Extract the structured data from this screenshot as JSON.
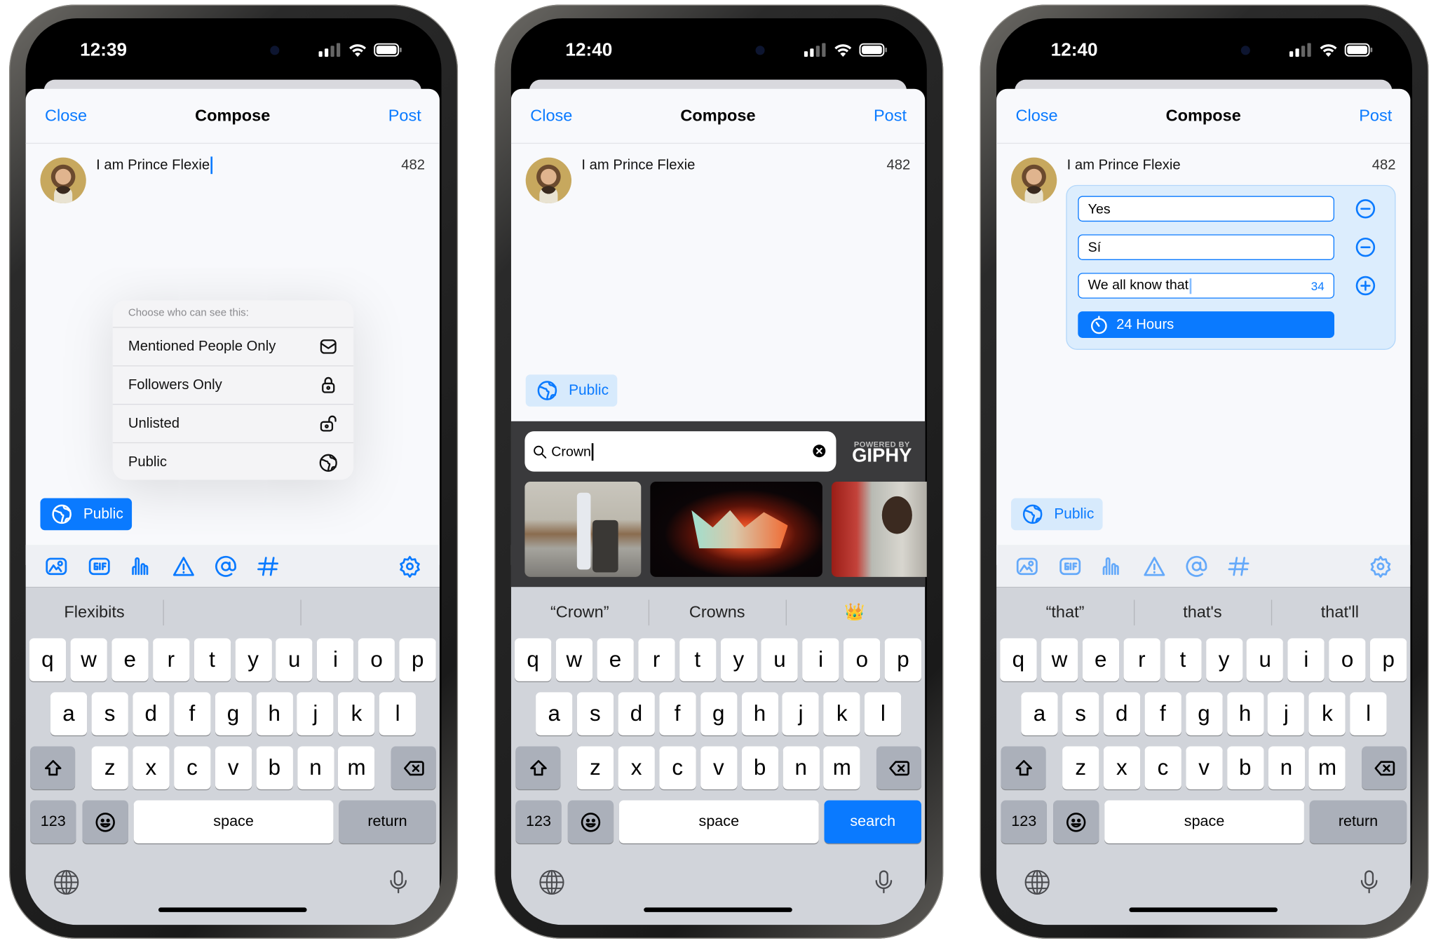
{
  "colors": {
    "accent": "#0a7aff",
    "keyboard_bg": "#d1d4da",
    "gif_panel_bg": "#3a3a3c",
    "poll_bg": "#dcedfd"
  },
  "toolbar_icons": [
    "image-icon",
    "gif-icon",
    "poll-icon",
    "warning-icon",
    "mention-icon",
    "hashtag-icon",
    "settings-icon"
  ],
  "keyboard": {
    "rows": [
      [
        "q",
        "w",
        "e",
        "r",
        "t",
        "y",
        "u",
        "i",
        "o",
        "p"
      ],
      [
        "a",
        "s",
        "d",
        "f",
        "g",
        "h",
        "j",
        "k",
        "l"
      ],
      [
        "z",
        "x",
        "c",
        "v",
        "b",
        "n",
        "m"
      ]
    ],
    "numbers": "123",
    "space": "space"
  },
  "phones": [
    {
      "status": {
        "time": "12:39"
      },
      "header": {
        "close": "Close",
        "title": "Compose",
        "post": "Post"
      },
      "post": {
        "text": "I am Prince Flexie",
        "char_count": "482"
      },
      "visibility_menu": {
        "prompt": "Choose who can see this:",
        "options": [
          {
            "label": "Mentioned People Only",
            "icon": "envelope-icon"
          },
          {
            "label": "Followers Only",
            "icon": "lock-icon"
          },
          {
            "label": "Unlisted",
            "icon": "unlock-icon"
          },
          {
            "label": "Public",
            "icon": "globe-icon"
          }
        ]
      },
      "visibility_button": {
        "label": "Public",
        "style": "filled"
      },
      "suggestions": [
        "Flexibits",
        "",
        ""
      ],
      "action_key": "return"
    },
    {
      "status": {
        "time": "12:40"
      },
      "header": {
        "close": "Close",
        "title": "Compose",
        "post": "Post"
      },
      "post": {
        "text": "I am Prince Flexie",
        "char_count": "482"
      },
      "visibility_button": {
        "label": "Public",
        "style": "light"
      },
      "gif_picker": {
        "query": "Crown",
        "attribution_top": "POWERED BY",
        "attribution_brand": "GIPHY"
      },
      "suggestions": [
        "“Crown”",
        "Crowns",
        "👑"
      ],
      "action_key": "search"
    },
    {
      "status": {
        "time": "12:40"
      },
      "header": {
        "close": "Close",
        "title": "Compose",
        "post": "Post"
      },
      "post": {
        "text": "I am Prince Flexie",
        "char_count": "482"
      },
      "poll": {
        "options": [
          "Yes",
          "Sí",
          "We all know that"
        ],
        "remaining_chars": "34",
        "option_actions": [
          "minus-circle-icon",
          "minus-circle-icon",
          "plus-circle-icon"
        ],
        "duration": "24 Hours"
      },
      "visibility_button": {
        "label": "Public",
        "style": "light"
      },
      "suggestions": [
        "“that”",
        "that's",
        "that'll"
      ],
      "action_key": "return"
    }
  ]
}
